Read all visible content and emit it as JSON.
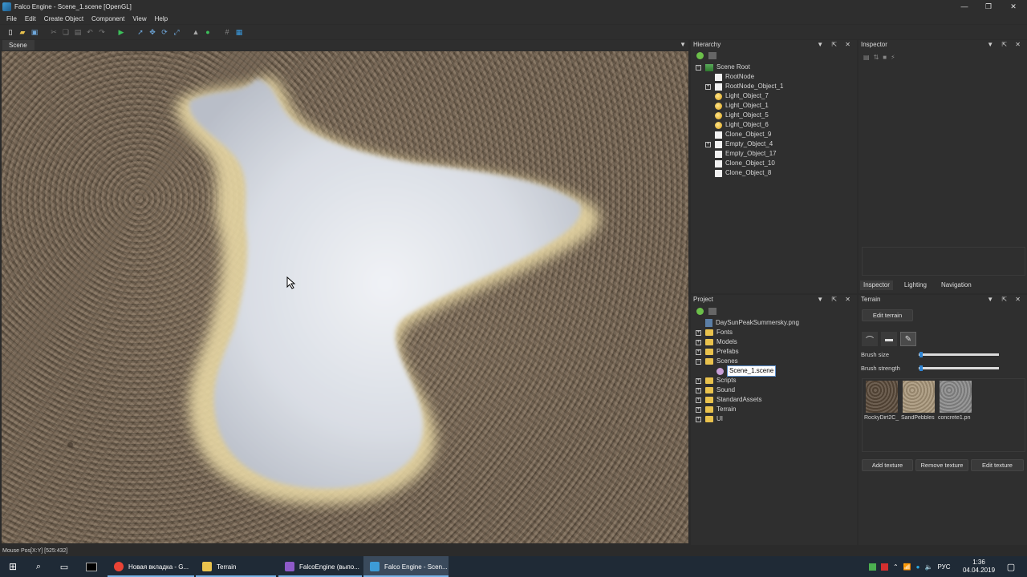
{
  "window": {
    "title": "Falco Engine - Scene_1.scene [OpenGL]"
  },
  "menu": [
    "File",
    "Edit",
    "Create Object",
    "Component",
    "View",
    "Help"
  ],
  "scene": {
    "tab_label": "Scene"
  },
  "status": {
    "mouse_pos": "Mouse Pos[X:Y] [525:432]"
  },
  "hierarchy": {
    "title": "Hierarchy",
    "root": "Scene Root",
    "items": [
      {
        "label": "RootNode",
        "type": "object",
        "expandable": false
      },
      {
        "label": "RootNode_Object_1",
        "type": "object",
        "expandable": true
      },
      {
        "label": "Light_Object_7",
        "type": "light",
        "expandable": false
      },
      {
        "label": "Light_Object_1",
        "type": "light",
        "expandable": false
      },
      {
        "label": "Light_Object_5",
        "type": "light",
        "expandable": false
      },
      {
        "label": "Light_Object_6",
        "type": "light",
        "expandable": false
      },
      {
        "label": "Clone_Object_9",
        "type": "object",
        "expandable": false
      },
      {
        "label": "Empty_Object_4",
        "type": "object",
        "expandable": true
      },
      {
        "label": "Empty_Object_17",
        "type": "object",
        "expandable": false
      },
      {
        "label": "Clone_Object_10",
        "type": "object",
        "expandable": false
      },
      {
        "label": "Clone_Object_8",
        "type": "object",
        "expandable": false
      }
    ]
  },
  "inspector": {
    "title": "Inspector",
    "tabs": [
      "Inspector",
      "Lighting",
      "Navigation"
    ]
  },
  "project": {
    "title": "Project",
    "items": [
      {
        "label": "DaySunPeakSummersky.png",
        "type": "file",
        "expandable": false,
        "level": 0
      },
      {
        "label": "Fonts",
        "type": "folder",
        "expandable": true,
        "level": 0
      },
      {
        "label": "Models",
        "type": "folder",
        "expandable": true,
        "level": 0
      },
      {
        "label": "Prefabs",
        "type": "folder",
        "expandable": true,
        "level": 0
      },
      {
        "label": "Scenes",
        "type": "folder",
        "expandable": true,
        "expanded": true,
        "level": 0
      },
      {
        "label": "Scene_1.scene",
        "type": "scene",
        "expandable": false,
        "level": 1,
        "selected": true
      },
      {
        "label": "Scripts",
        "type": "folder",
        "expandable": true,
        "level": 0
      },
      {
        "label": "Sound",
        "type": "folder",
        "expandable": true,
        "level": 0
      },
      {
        "label": "StandardAssets",
        "type": "folder",
        "expandable": true,
        "level": 0
      },
      {
        "label": "Terrain",
        "type": "folder",
        "expandable": true,
        "level": 0
      },
      {
        "label": "UI",
        "type": "folder",
        "expandable": true,
        "level": 0
      }
    ]
  },
  "terrain": {
    "title": "Terrain",
    "edit_button": "Edit terrain",
    "brush_size_label": "Brush size",
    "brush_strength_label": "Brush strength",
    "brush_size_value": 0.01,
    "brush_strength_value": 0.01,
    "textures": [
      {
        "label": "RockyDirt2C_",
        "color": "#5a4a3a"
      },
      {
        "label": "SandPebbles",
        "color": "#a8967a"
      },
      {
        "label": "concrete1.pn",
        "color": "#8a8a8a"
      }
    ],
    "add_texture": "Add texture",
    "remove_texture": "Remove texture",
    "edit_texture": "Edit texture"
  },
  "taskbar": {
    "items": [
      {
        "label": "Новая вкладка - G...",
        "icon": "chrome-icon"
      },
      {
        "label": "Terrain",
        "icon": "folder-icon"
      },
      {
        "label": "FalcoEngine (выпо...",
        "icon": "visual-studio-icon"
      },
      {
        "label": "Falco Engine - Scen...",
        "icon": "falco-engine-icon"
      }
    ],
    "lang": "РУС",
    "time": "1:36",
    "date": "04.04.2019"
  }
}
